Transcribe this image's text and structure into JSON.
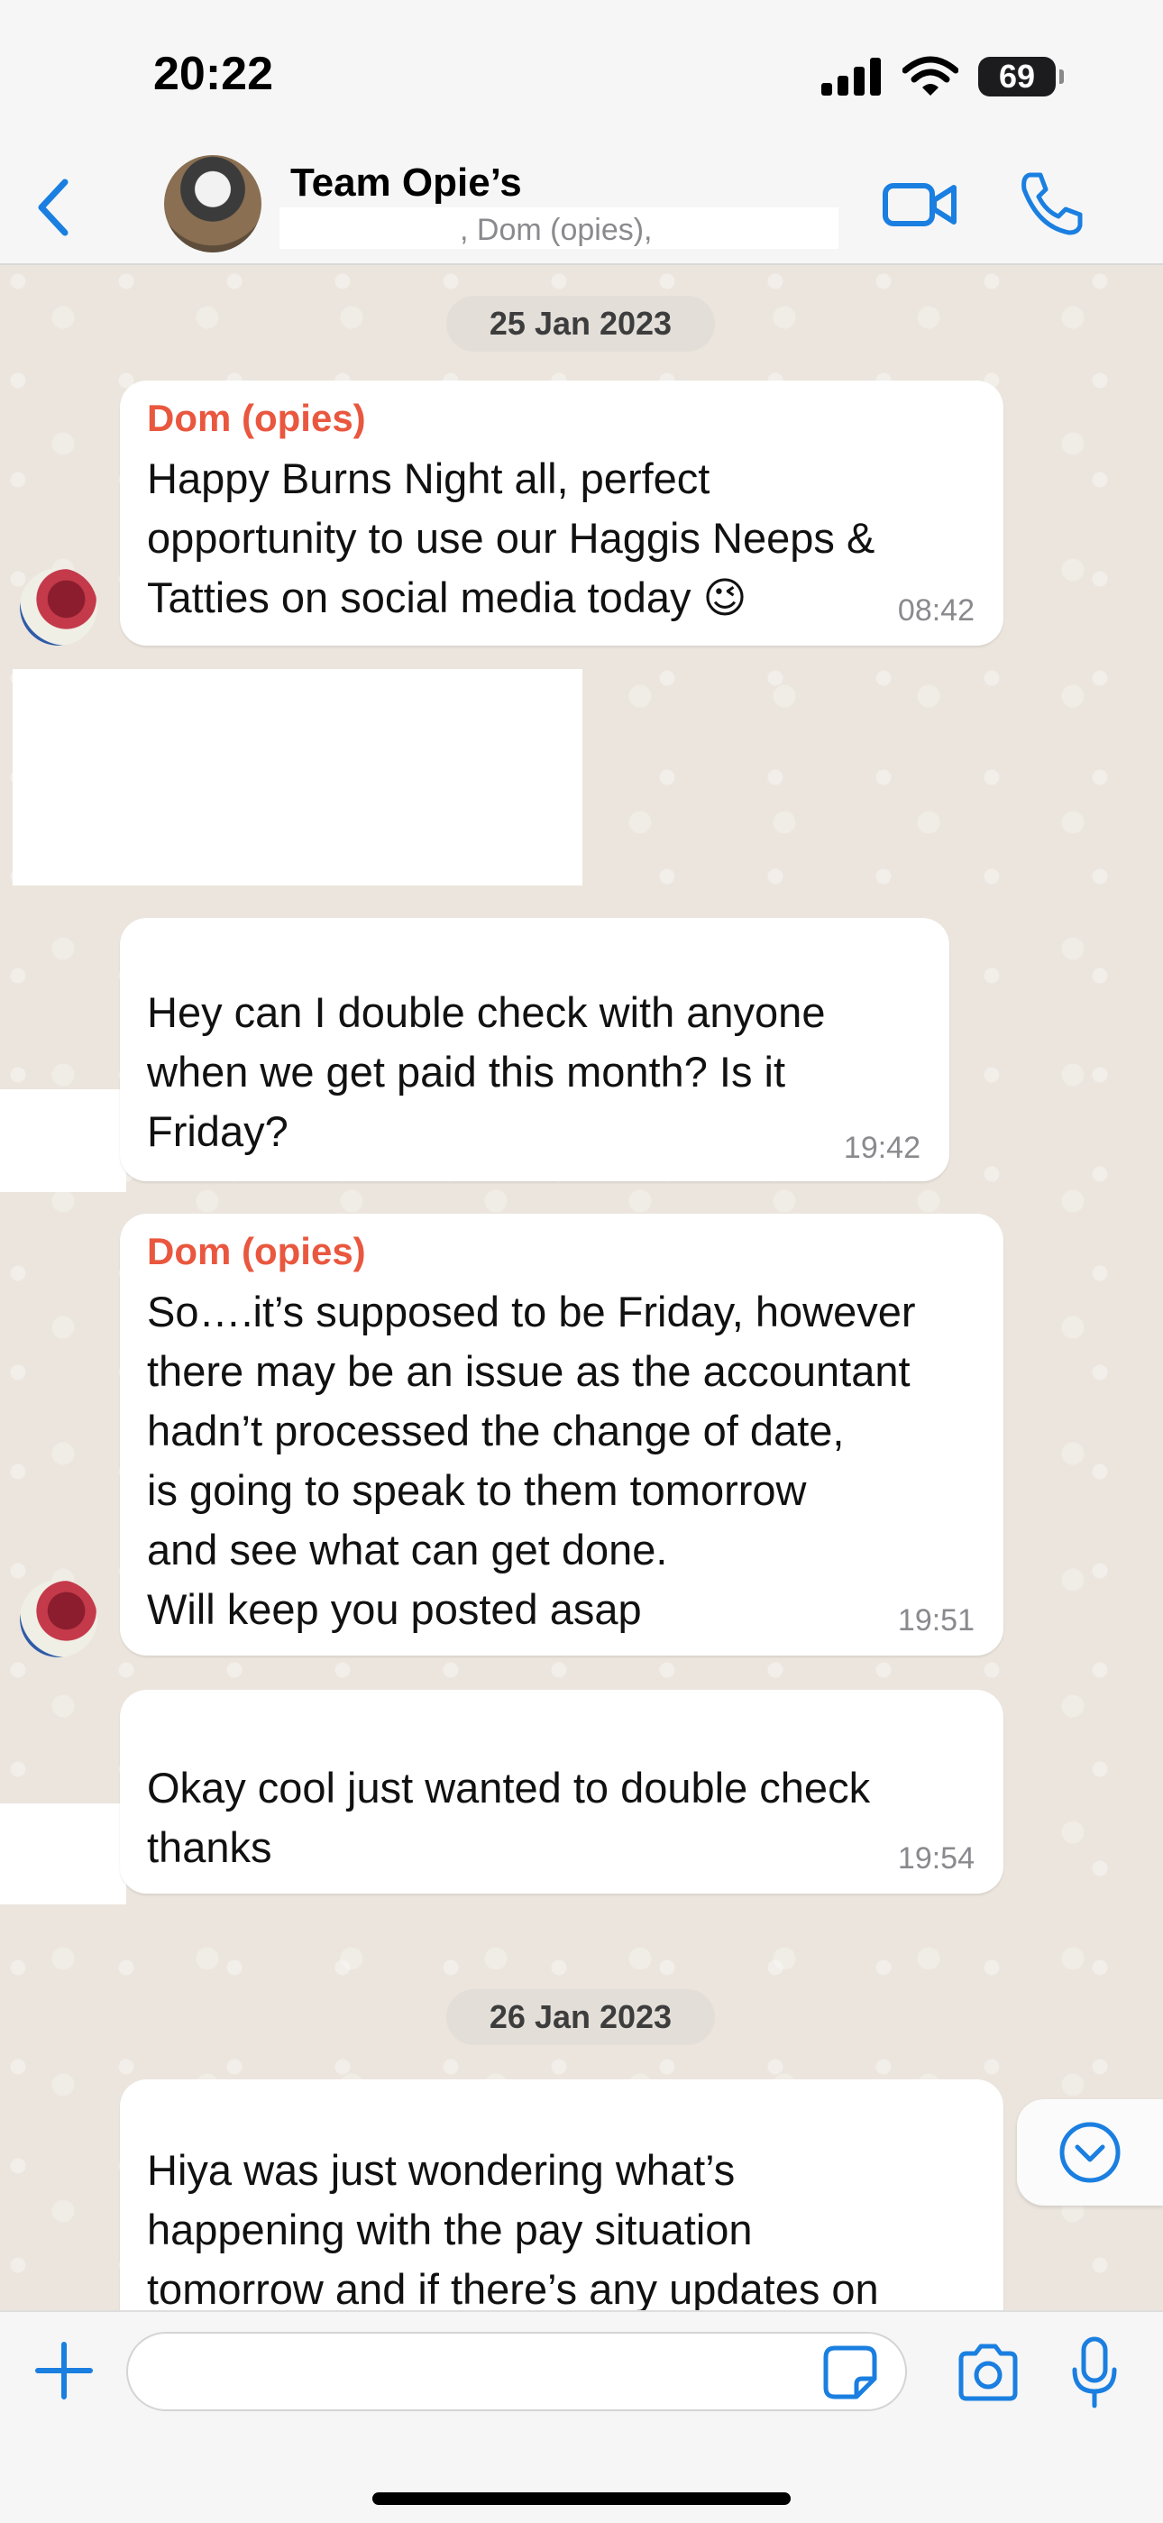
{
  "status_bar": {
    "time": "20:22",
    "battery": "69"
  },
  "header": {
    "title": "Team Opie’s",
    "members": ", Dom (opies),",
    "icons": [
      "back-chevron-icon",
      "video-call-icon",
      "phone-call-icon"
    ]
  },
  "colors": {
    "accent": "#1a7fe0",
    "sender_name": "#e9573f",
    "wallpaper": "#ebe5dd"
  },
  "messages": {
    "date1": "25 Jan 2023",
    "m1": {
      "sender": "Dom (opies)",
      "text": "Happy Burns Night all, perfect\nopportunity to use our Haggis Neeps &\nTatties on social media today 😉",
      "time": "08:42"
    },
    "m2": {
      "text": "Hey can I double check with anyone\nwhen we get paid this month? Is it\nFriday?",
      "time": "19:42"
    },
    "m3": {
      "sender": "Dom (opies)",
      "text": "So….it’s supposed to be Friday, however\nthere may be an issue as the accountant\nhadn’t processed the change of date,\n        is going to speak to them tomorrow\nand see what can get done.\nWill keep you posted asap",
      "time": "19:51"
    },
    "m4": {
      "text": "Okay cool just wanted to double check\nthanks",
      "time": "19:54"
    },
    "date2": "26 Jan 2023",
    "m5": {
      "text": "Hiya was just wondering what’s\nhappening with the pay situation\ntomorrow and if there’s any updates on"
    }
  },
  "composer": {
    "value": "",
    "placeholder": ""
  }
}
